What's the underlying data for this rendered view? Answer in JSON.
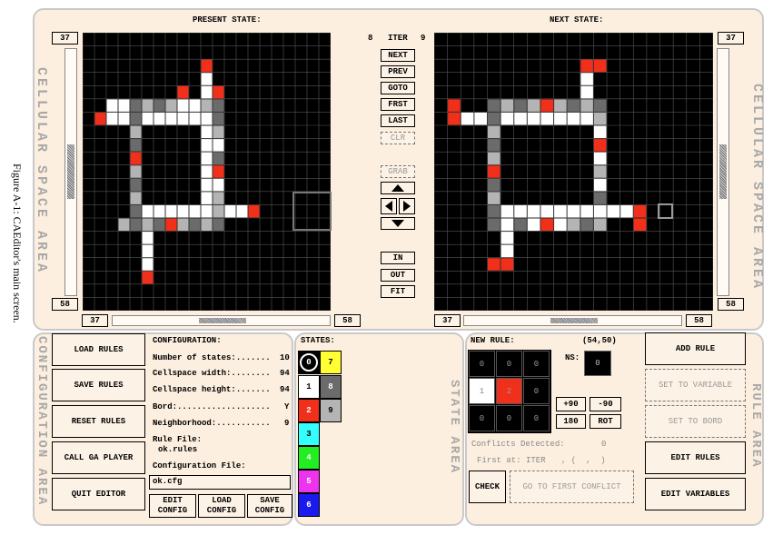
{
  "caption": "Figure A-1: CAEditor's main screen.",
  "cellular": {
    "present_title": "PRESENT STATE:",
    "next_title": "NEXT STATE:",
    "area_label": "CELLULAR SPACE AREA",
    "iter_left": "8",
    "iter_label": "ITER",
    "iter_right": "9",
    "present_row_top": "37",
    "present_row_bottom": "58",
    "present_col_left": "37",
    "present_col_right": "58",
    "next_row_top": "37",
    "next_row_bottom": "58",
    "next_col_left": "37",
    "next_col_right": "58",
    "present_vscroll_fraction": 0.55,
    "present_hscroll_fraction": 0.5,
    "next_vscroll_fraction": 0.55,
    "next_hscroll_fraction": 0.5,
    "buttons": {
      "next": "NEXT",
      "prev": "PREV",
      "goto": "GOTO",
      "frst": "FRST",
      "last": "LAST",
      "clr": "CLR",
      "grab": "GRAB",
      "in": "IN",
      "out": "OUT",
      "fit": "FIT"
    },
    "arrow_icons": [
      "arrow-up",
      "arrow-left",
      "arrow-right",
      "arrow-down"
    ],
    "grid_size": 21,
    "present_cells": [
      {
        "r": 2,
        "c": 10,
        "s": 2
      },
      {
        "r": 3,
        "c": 10,
        "s": 1
      },
      {
        "r": 4,
        "c": 10,
        "s": 1
      },
      {
        "r": 5,
        "c": 2,
        "s": 1
      },
      {
        "r": 5,
        "c": 3,
        "s": 1
      },
      {
        "r": 5,
        "c": 4,
        "s": 8
      },
      {
        "r": 5,
        "c": 5,
        "s": 9
      },
      {
        "r": 5,
        "c": 6,
        "s": 8
      },
      {
        "r": 5,
        "c": 7,
        "s": 9
      },
      {
        "r": 5,
        "c": 8,
        "s": 1
      },
      {
        "r": 5,
        "c": 9,
        "s": 1
      },
      {
        "r": 5,
        "c": 10,
        "s": 9
      },
      {
        "r": 5,
        "c": 11,
        "s": 8
      },
      {
        "r": 4,
        "c": 8,
        "s": 2
      },
      {
        "r": 4,
        "c": 11,
        "s": 2
      },
      {
        "r": 6,
        "c": 1,
        "s": 2
      },
      {
        "r": 6,
        "c": 4,
        "s": 8
      },
      {
        "r": 6,
        "c": 5,
        "s": 1
      },
      {
        "r": 6,
        "c": 6,
        "s": 1
      },
      {
        "r": 6,
        "c": 7,
        "s": 1
      },
      {
        "r": 6,
        "c": 8,
        "s": 1
      },
      {
        "r": 6,
        "c": 9,
        "s": 1
      },
      {
        "r": 6,
        "c": 10,
        "s": 1
      },
      {
        "r": 6,
        "c": 11,
        "s": 8
      },
      {
        "r": 6,
        "c": 2,
        "s": 1
      },
      {
        "r": 6,
        "c": 3,
        "s": 1
      },
      {
        "r": 7,
        "c": 4,
        "s": 9
      },
      {
        "r": 7,
        "c": 10,
        "s": 1
      },
      {
        "r": 7,
        "c": 11,
        "s": 9
      },
      {
        "r": 8,
        "c": 4,
        "s": 8
      },
      {
        "r": 8,
        "c": 10,
        "s": 1
      },
      {
        "r": 8,
        "c": 11,
        "s": 1
      },
      {
        "r": 9,
        "c": 4,
        "s": 2
      },
      {
        "r": 9,
        "c": 10,
        "s": 1
      },
      {
        "r": 9,
        "c": 11,
        "s": 8
      },
      {
        "r": 10,
        "c": 4,
        "s": 9
      },
      {
        "r": 10,
        "c": 10,
        "s": 1
      },
      {
        "r": 10,
        "c": 11,
        "s": 2
      },
      {
        "r": 11,
        "c": 4,
        "s": 8
      },
      {
        "r": 11,
        "c": 10,
        "s": 1
      },
      {
        "r": 11,
        "c": 11,
        "s": 1
      },
      {
        "r": 12,
        "c": 4,
        "s": 9
      },
      {
        "r": 12,
        "c": 10,
        "s": 1
      },
      {
        "r": 12,
        "c": 11,
        "s": 9
      },
      {
        "r": 13,
        "c": 4,
        "s": 8
      },
      {
        "r": 13,
        "c": 5,
        "s": 1
      },
      {
        "r": 13,
        "c": 6,
        "s": 1
      },
      {
        "r": 13,
        "c": 7,
        "s": 1
      },
      {
        "r": 13,
        "c": 8,
        "s": 1
      },
      {
        "r": 13,
        "c": 9,
        "s": 1
      },
      {
        "r": 13,
        "c": 10,
        "s": 1
      },
      {
        "r": 13,
        "c": 11,
        "s": 9
      },
      {
        "r": 13,
        "c": 12,
        "s": 1
      },
      {
        "r": 13,
        "c": 13,
        "s": 1
      },
      {
        "r": 13,
        "c": 14,
        "s": 2
      },
      {
        "r": 14,
        "c": 3,
        "s": 9
      },
      {
        "r": 14,
        "c": 4,
        "s": 8
      },
      {
        "r": 14,
        "c": 5,
        "s": 9
      },
      {
        "r": 14,
        "c": 6,
        "s": 8
      },
      {
        "r": 14,
        "c": 7,
        "s": 2
      },
      {
        "r": 14,
        "c": 8,
        "s": 9
      },
      {
        "r": 14,
        "c": 9,
        "s": 8
      },
      {
        "r": 14,
        "c": 10,
        "s": 9
      },
      {
        "r": 14,
        "c": 11,
        "s": 8
      },
      {
        "r": 15,
        "c": 5,
        "s": 1
      },
      {
        "r": 16,
        "c": 5,
        "s": 1
      },
      {
        "r": 17,
        "c": 5,
        "s": 1
      },
      {
        "r": 18,
        "c": 5,
        "s": 2
      }
    ],
    "next_cells": [
      {
        "r": 2,
        "c": 11,
        "s": 2
      },
      {
        "r": 2,
        "c": 12,
        "s": 2
      },
      {
        "r": 3,
        "c": 11,
        "s": 1
      },
      {
        "r": 4,
        "c": 11,
        "s": 1
      },
      {
        "r": 5,
        "c": 1,
        "s": 2
      },
      {
        "r": 5,
        "c": 4,
        "s": 8
      },
      {
        "r": 5,
        "c": 5,
        "s": 9
      },
      {
        "r": 5,
        "c": 6,
        "s": 8
      },
      {
        "r": 5,
        "c": 7,
        "s": 9
      },
      {
        "r": 5,
        "c": 8,
        "s": 2
      },
      {
        "r": 5,
        "c": 9,
        "s": 9
      },
      {
        "r": 5,
        "c": 10,
        "s": 8
      },
      {
        "r": 5,
        "c": 11,
        "s": 9
      },
      {
        "r": 5,
        "c": 12,
        "s": 8
      },
      {
        "r": 6,
        "c": 1,
        "s": 2
      },
      {
        "r": 6,
        "c": 2,
        "s": 1
      },
      {
        "r": 6,
        "c": 3,
        "s": 1
      },
      {
        "r": 6,
        "c": 4,
        "s": 8
      },
      {
        "r": 6,
        "c": 5,
        "s": 1
      },
      {
        "r": 6,
        "c": 6,
        "s": 1
      },
      {
        "r": 6,
        "c": 7,
        "s": 1
      },
      {
        "r": 6,
        "c": 8,
        "s": 1
      },
      {
        "r": 6,
        "c": 9,
        "s": 1
      },
      {
        "r": 6,
        "c": 10,
        "s": 1
      },
      {
        "r": 6,
        "c": 11,
        "s": 1
      },
      {
        "r": 6,
        "c": 12,
        "s": 9
      },
      {
        "r": 7,
        "c": 4,
        "s": 9
      },
      {
        "r": 7,
        "c": 12,
        "s": 1
      },
      {
        "r": 8,
        "c": 4,
        "s": 8
      },
      {
        "r": 8,
        "c": 12,
        "s": 2
      },
      {
        "r": 9,
        "c": 4,
        "s": 9
      },
      {
        "r": 9,
        "c": 12,
        "s": 1
      },
      {
        "r": 10,
        "c": 4,
        "s": 2
      },
      {
        "r": 10,
        "c": 12,
        "s": 9
      },
      {
        "r": 11,
        "c": 4,
        "s": 8
      },
      {
        "r": 11,
        "c": 12,
        "s": 1
      },
      {
        "r": 12,
        "c": 4,
        "s": 9
      },
      {
        "r": 12,
        "c": 12,
        "s": 8
      },
      {
        "r": 13,
        "c": 4,
        "s": 8
      },
      {
        "r": 13,
        "c": 5,
        "s": 1
      },
      {
        "r": 13,
        "c": 6,
        "s": 1
      },
      {
        "r": 13,
        "c": 7,
        "s": 1
      },
      {
        "r": 13,
        "c": 8,
        "s": 1
      },
      {
        "r": 13,
        "c": 9,
        "s": 1
      },
      {
        "r": 13,
        "c": 10,
        "s": 1
      },
      {
        "r": 13,
        "c": 11,
        "s": 1
      },
      {
        "r": 13,
        "c": 12,
        "s": 1
      },
      {
        "r": 13,
        "c": 13,
        "s": 1
      },
      {
        "r": 13,
        "c": 14,
        "s": 1
      },
      {
        "r": 13,
        "c": 15,
        "s": 2
      },
      {
        "r": 14,
        "c": 4,
        "s": 8
      },
      {
        "r": 14,
        "c": 5,
        "s": 1
      },
      {
        "r": 14,
        "c": 6,
        "s": 8
      },
      {
        "r": 14,
        "c": 7,
        "s": 1
      },
      {
        "r": 14,
        "c": 8,
        "s": 2
      },
      {
        "r": 14,
        "c": 9,
        "s": 1
      },
      {
        "r": 14,
        "c": 10,
        "s": 9
      },
      {
        "r": 14,
        "c": 11,
        "s": 8
      },
      {
        "r": 14,
        "c": 12,
        "s": 9
      },
      {
        "r": 14,
        "c": 15,
        "s": 2
      },
      {
        "r": 15,
        "c": 5,
        "s": 1
      },
      {
        "r": 16,
        "c": 5,
        "s": 1
      },
      {
        "r": 17,
        "c": 5,
        "s": 2
      },
      {
        "r": 17,
        "c": 4,
        "s": 2
      }
    ]
  },
  "configuration": {
    "area_label": "CONFIGURATION AREA",
    "buttons": {
      "load_rules": "LOAD RULES",
      "save_rules": "SAVE RULES",
      "reset_rules": "RESET RULES",
      "call_ga_player": "CALL GA PLAYER",
      "quit_editor": "QUIT EDITOR",
      "edit_config": "EDIT\nCONFIG",
      "load_config": "LOAD\nCONFIG",
      "save_config": "SAVE\nCONFIG"
    },
    "title": "CONFIGURATION:",
    "rows": [
      {
        "label": "Number of states:.......",
        "value": "10"
      },
      {
        "label": "Cellspace width:........",
        "value": "94"
      },
      {
        "label": "Cellspace height:.......",
        "value": "94"
      },
      {
        "label": "Bord:...................",
        "value": "Y"
      },
      {
        "label": "Neighborhood:...........",
        "value": "9"
      }
    ],
    "rule_file_label": "Rule File:",
    "rule_file_value": "ok.rules",
    "config_file_label": "Configuration File:",
    "config_file_value": "ok.cfg"
  },
  "states": {
    "title": "STATES:",
    "area_label": "STATE AREA",
    "swatches": [
      {
        "label": "0",
        "color": "#000000",
        "text": "#ffffff"
      },
      {
        "label": "7",
        "color": "#ffff33",
        "text": "#000000"
      },
      {
        "label": "1",
        "color": "#ffffff",
        "text": "#000000"
      },
      {
        "label": "8",
        "color": "#6b6b6b",
        "text": "#ffffff"
      },
      {
        "label": "2",
        "color": "#f0301a",
        "text": "#ffffff"
      },
      {
        "label": "9",
        "color": "#b4b4b4",
        "text": "#000000"
      },
      {
        "label": "3",
        "color": "#33ffff",
        "text": "#000000"
      },
      {
        "label": "4",
        "color": "#22ee22",
        "text": "#ffffff"
      },
      {
        "label": "5",
        "color": "#ee33ee",
        "text": "#ffffff"
      },
      {
        "label": "6",
        "color": "#1a1aee",
        "text": "#ffffff"
      }
    ]
  },
  "rule": {
    "area_label": "RULE AREA",
    "new_rule_label": "NEW RULE:",
    "coords": "(54,50)",
    "ns_label": "NS:",
    "ns_value": "0",
    "neighborhood": [
      "0",
      "0",
      "0",
      "1",
      "2",
      "0",
      "0",
      "0",
      "0"
    ],
    "neighborhood_colors": [
      "#000000",
      "#000000",
      "#000000",
      "#ffffff",
      "#f0301a",
      "#000000",
      "#000000",
      "#000000",
      "#000000"
    ],
    "buttons": {
      "plus90": "+90",
      "minus90": "-90",
      "r180": "180",
      "rot": "ROT",
      "add_rule": "ADD RULE",
      "set_to_variable": "SET TO VARIABLE",
      "set_to_bord": "SET TO BORD",
      "edit_rules": "EDIT RULES",
      "edit_variables": "EDIT VARIABLES",
      "check": "CHECK",
      "go_to_first_conflict": "GO TO FIRST CONFLICT"
    },
    "conflicts_label": "Conflicts Detected:",
    "conflicts_value": "0",
    "first_at_label": "First at: ITER",
    "first_at_value": ", (  ,  )"
  }
}
